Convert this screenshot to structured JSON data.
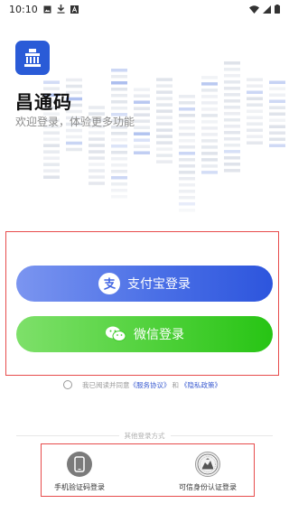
{
  "status_bar": {
    "time": "10:10",
    "icons": [
      "image-icon",
      "download-icon",
      "notification-a-icon",
      "wifi-icon",
      "signal-icon",
      "battery-icon"
    ]
  },
  "app": {
    "name": "昌通码",
    "subtitle": "欢迎登录，体验更多功能",
    "logo_icon": "building-icon",
    "brand_color": "#2a5bd7"
  },
  "login": {
    "alipay_label": "支付宝登录",
    "alipay_icon": "alipay-icon",
    "wechat_label": "微信登录",
    "wechat_icon": "wechat-icon",
    "alipay_color": "#3f63e3",
    "wechat_color": "#3fcb2b"
  },
  "agreement": {
    "prefix": "我已阅读并同意",
    "service_link": "《服务协议》",
    "conjunction": "和",
    "privacy_link": "《隐私政策》"
  },
  "other_login": {
    "divider_text": "其他登录方式",
    "phone_label": "手机验证码登录",
    "phone_icon": "phone-icon",
    "id_label": "可信身份认证登录",
    "id_icon": "emblem-icon"
  },
  "highlight_color": "#e74c4c"
}
